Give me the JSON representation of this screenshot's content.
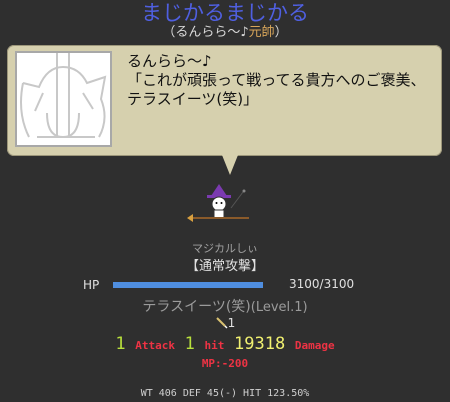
{
  "header": {
    "title": "まじかるまじかる",
    "speaker": "（るんらら～♪",
    "speaker_class": "元帥",
    "speaker_close": "）"
  },
  "dialog": {
    "line1": "るんらら～♪",
    "line2": "「これが頑張って戦ってる貴方へのご褒美、",
    "line3": "テラスイーツ(笑)」"
  },
  "battle": {
    "monster_name": "マジカルしぃ",
    "attack_type": "【通常攻撃】",
    "hp_label": "HP",
    "hp_current": "3100",
    "hp_max": "/3100",
    "hp_fraction": 1.0,
    "skill_name": "テラスイーツ(笑)",
    "skill_level": "(Level.1)",
    "weapon_count": "1",
    "hits": "1",
    "attack_label": "Attack",
    "hit_count": "1",
    "hit_label": "hit",
    "damage": "19318",
    "damage_label": "Damage",
    "mp_cost": "MP:-200",
    "stats": "WT 406 DEF 45(-) HIT 123.50%"
  },
  "colors": {
    "title": "#4f5fe0",
    "hp_bar": "#4f8ee0",
    "bubble": "#d6d0ae",
    "damage_red": "#ee3344",
    "number_green": "#b8e03c"
  },
  "icons": [
    "witch-sprite-icon",
    "pencil-weapon-icon",
    "portrait-placeholder-icon"
  ]
}
